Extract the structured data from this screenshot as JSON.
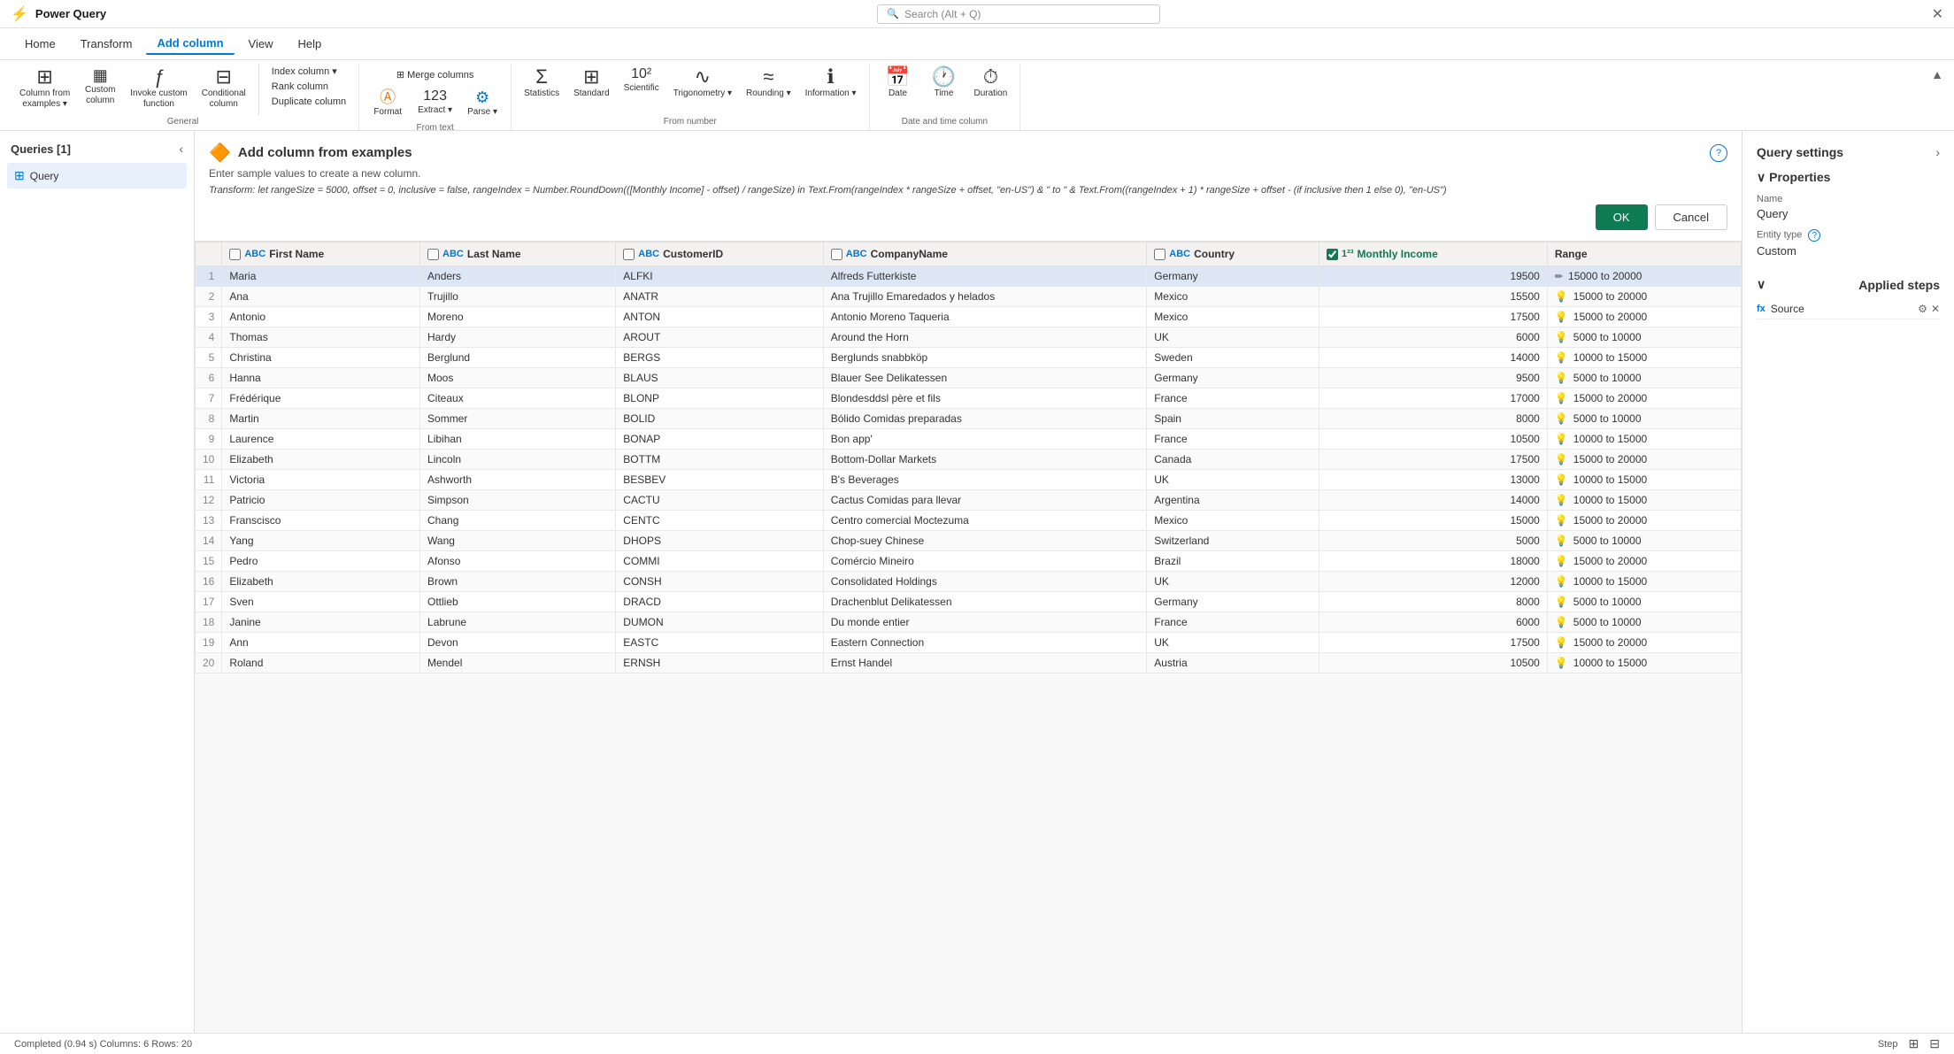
{
  "app": {
    "title": "Power Query",
    "close_label": "✕"
  },
  "search": {
    "placeholder": "Search (Alt + Q)"
  },
  "menu": {
    "items": [
      {
        "label": "Home",
        "active": false
      },
      {
        "label": "Transform",
        "active": false
      },
      {
        "label": "Add column",
        "active": true
      },
      {
        "label": "View",
        "active": false
      },
      {
        "label": "Help",
        "active": false
      }
    ]
  },
  "ribbon": {
    "groups": [
      {
        "label": "General",
        "buttons": [
          {
            "icon": "⊞",
            "label": "Column from\nexamples",
            "has_arrow": true
          },
          {
            "icon": "▦",
            "label": "Custom\ncolumn"
          },
          {
            "icon": "ƒ",
            "label": "Invoke custom\nfunction"
          },
          {
            "icon": "⊟",
            "label": "Conditional\ncolumn"
          }
        ],
        "small_buttons": [
          {
            "label": "Index column ▾"
          },
          {
            "label": "Rank column"
          },
          {
            "label": "Duplicate column"
          }
        ]
      },
      {
        "label": "From text",
        "buttons": [
          {
            "icon": "Ⓐ",
            "label": "Format"
          },
          {
            "icon": "123",
            "label": "Extract ▾"
          },
          {
            "icon": "⚙",
            "label": "Parse ▾"
          }
        ],
        "merge_label": "Merge columns"
      },
      {
        "label": "From number",
        "buttons": [
          {
            "icon": "Σ",
            "label": "Statistics"
          },
          {
            "icon": "⊞",
            "label": "Standard"
          },
          {
            "icon": "10²",
            "label": "Scientific"
          },
          {
            "icon": "∿",
            "label": "Trigonometry ▾"
          },
          {
            "icon": "≈",
            "label": "Rounding ▾"
          },
          {
            "icon": "ℹ",
            "label": "Information ▾"
          }
        ]
      },
      {
        "label": "Date and time column",
        "buttons": [
          {
            "icon": "📅",
            "label": "Date"
          },
          {
            "icon": "🕐",
            "label": "Time"
          },
          {
            "icon": "⏱",
            "label": "Duration"
          }
        ]
      }
    ],
    "collapse_label": "▲"
  },
  "sidebar": {
    "title": "Queries [1]",
    "collapse_icon": "‹",
    "items": [
      {
        "label": "Query",
        "icon": "⊞",
        "active": true
      }
    ]
  },
  "panel": {
    "icon": "🔶",
    "title": "Add column from examples",
    "description": "Enter sample values to create a new column.",
    "transform": "Transform: let rangeSize = 5000, offset = 0, inclusive = false, rangeIndex = Number.RoundDown(([Monthly Income] - offset) / rangeSize) in Text.From(rangeIndex * rangeSize + offset, \"en-US\") & \" to \" & Text.From((rangeIndex + 1) * rangeSize + offset - (if inclusive then 1 else 0), \"en-US\")",
    "ok_label": "OK",
    "cancel_label": "Cancel",
    "help_label": "?"
  },
  "table": {
    "columns": [
      {
        "label": "First Name",
        "type": "ABC",
        "checked": false
      },
      {
        "label": "Last Name",
        "type": "ABC",
        "checked": false
      },
      {
        "label": "CustomerID",
        "type": "ABC",
        "checked": false
      },
      {
        "label": "CompanyName",
        "type": "ABC",
        "checked": false
      },
      {
        "label": "Country",
        "type": "ABC",
        "checked": false
      },
      {
        "label": "Monthly Income",
        "type": "123",
        "checked": true
      },
      {
        "label": "Range",
        "type": "",
        "checked": false
      }
    ],
    "rows": [
      {
        "num": 1,
        "first": "Maria",
        "last": "Anders",
        "id": "ALFKI",
        "company": "Alfreds Futterkiste",
        "country": "Germany",
        "income": "19500",
        "range": "15000 to 20000",
        "selected": true
      },
      {
        "num": 2,
        "first": "Ana",
        "last": "Trujillo",
        "id": "ANATR",
        "company": "Ana Trujillo Emaredados y helados",
        "country": "Mexico",
        "income": "15500",
        "range": "15000 to 20000"
      },
      {
        "num": 3,
        "first": "Antonio",
        "last": "Moreno",
        "id": "ANTON",
        "company": "Antonio Moreno Taqueria",
        "country": "Mexico",
        "income": "17500",
        "range": "15000 to 20000"
      },
      {
        "num": 4,
        "first": "Thomas",
        "last": "Hardy",
        "id": "AROUT",
        "company": "Around the Horn",
        "country": "UK",
        "income": "6000",
        "range": "5000 to 10000"
      },
      {
        "num": 5,
        "first": "Christina",
        "last": "Berglund",
        "id": "BERGS",
        "company": "Berglunds snabbköp",
        "country": "Sweden",
        "income": "14000",
        "range": "10000 to 15000"
      },
      {
        "num": 6,
        "first": "Hanna",
        "last": "Moos",
        "id": "BLAUS",
        "company": "Blauer See Delikatessen",
        "country": "Germany",
        "income": "9500",
        "range": "5000 to 10000"
      },
      {
        "num": 7,
        "first": "Frédérique",
        "last": "Citeaux",
        "id": "BLONP",
        "company": "Blondesddsl père et fils",
        "country": "France",
        "income": "17000",
        "range": "15000 to 20000"
      },
      {
        "num": 8,
        "first": "Martin",
        "last": "Sommer",
        "id": "BOLID",
        "company": "Bólido Comidas preparadas",
        "country": "Spain",
        "income": "8000",
        "range": "5000 to 10000"
      },
      {
        "num": 9,
        "first": "Laurence",
        "last": "Libihan",
        "id": "BONAP",
        "company": "Bon app'",
        "country": "France",
        "income": "10500",
        "range": "10000 to 15000"
      },
      {
        "num": 10,
        "first": "Elizabeth",
        "last": "Lincoln",
        "id": "BOTTM",
        "company": "Bottom-Dollar Markets",
        "country": "Canada",
        "income": "17500",
        "range": "15000 to 20000"
      },
      {
        "num": 11,
        "first": "Victoria",
        "last": "Ashworth",
        "id": "BESBEV",
        "company": "B's Beverages",
        "country": "UK",
        "income": "13000",
        "range": "10000 to 15000"
      },
      {
        "num": 12,
        "first": "Patricio",
        "last": "Simpson",
        "id": "CACTU",
        "company": "Cactus Comidas para llevar",
        "country": "Argentina",
        "income": "14000",
        "range": "10000 to 15000"
      },
      {
        "num": 13,
        "first": "Franscisco",
        "last": "Chang",
        "id": "CENTC",
        "company": "Centro comercial Moctezuma",
        "country": "Mexico",
        "income": "15000",
        "range": "15000 to 20000"
      },
      {
        "num": 14,
        "first": "Yang",
        "last": "Wang",
        "id": "DHOPS",
        "company": "Chop-suey Chinese",
        "country": "Switzerland",
        "income": "5000",
        "range": "5000 to 10000"
      },
      {
        "num": 15,
        "first": "Pedro",
        "last": "Afonso",
        "id": "COMMI",
        "company": "Comércio Mineiro",
        "country": "Brazil",
        "income": "18000",
        "range": "15000 to 20000"
      },
      {
        "num": 16,
        "first": "Elizabeth",
        "last": "Brown",
        "id": "CONSH",
        "company": "Consolidated Holdings",
        "country": "UK",
        "income": "12000",
        "range": "10000 to 15000"
      },
      {
        "num": 17,
        "first": "Sven",
        "last": "Ottlieb",
        "id": "DRACD",
        "company": "Drachenblut Delikatessen",
        "country": "Germany",
        "income": "8000",
        "range": "5000 to 10000"
      },
      {
        "num": 18,
        "first": "Janine",
        "last": "Labrune",
        "id": "DUMON",
        "company": "Du monde entier",
        "country": "France",
        "income": "6000",
        "range": "5000 to 10000"
      },
      {
        "num": 19,
        "first": "Ann",
        "last": "Devon",
        "id": "EASTC",
        "company": "Eastern Connection",
        "country": "UK",
        "income": "17500",
        "range": "15000 to 20000"
      },
      {
        "num": 20,
        "first": "Roland",
        "last": "Mendel",
        "id": "ERNSH",
        "company": "Ernst Handel",
        "country": "Austria",
        "income": "10500",
        "range": "10000 to 15000"
      }
    ]
  },
  "query_settings": {
    "title": "Query settings",
    "chevron": "›",
    "properties_label": "Properties",
    "name_label": "Name",
    "name_value": "Query",
    "entity_type_label": "Entity type",
    "entity_type_value": "Custom",
    "applied_steps_label": "Applied steps",
    "steps": [
      {
        "icon": "fx",
        "label": "Source"
      }
    ]
  },
  "status": {
    "text": "Completed (0.94 s)    Columns: 6    Rows: 20",
    "step_label": "Step",
    "icons": [
      "⊞",
      "⊟"
    ]
  }
}
